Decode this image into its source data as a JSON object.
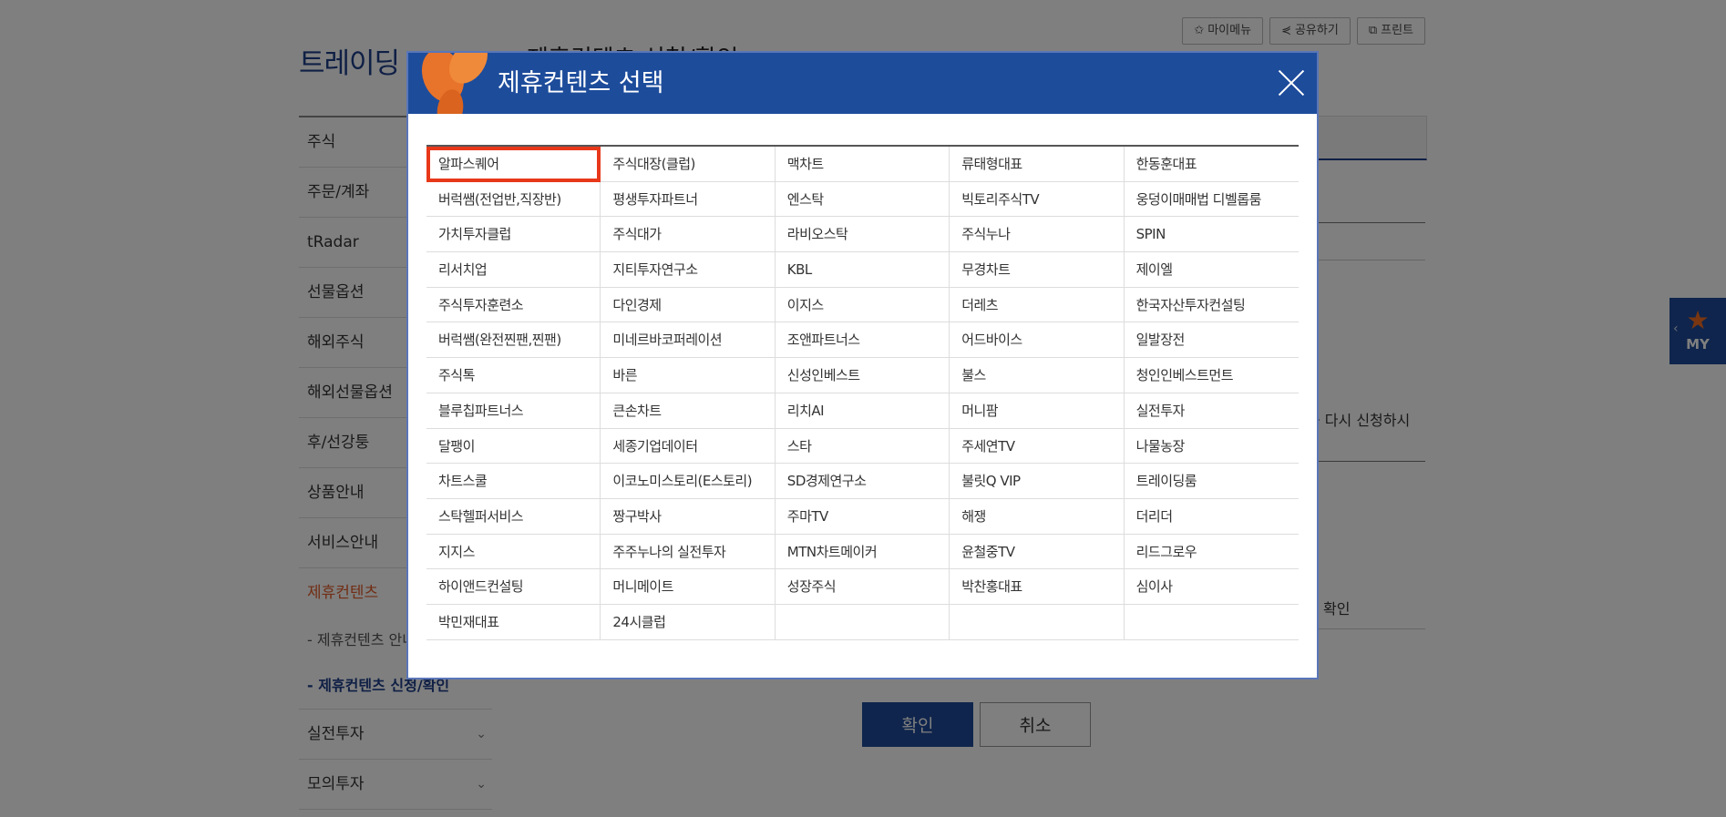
{
  "page": {
    "title": "트레이딩",
    "heading": "제휴컨텐츠 신청/확인",
    "tools": [
      {
        "icon": "star-icon",
        "glyph": "✩",
        "label": "마이메뉴"
      },
      {
        "icon": "share-icon",
        "glyph": "⋞",
        "label": "공유하기"
      },
      {
        "icon": "print-icon",
        "glyph": "⧉",
        "label": "프린트"
      }
    ],
    "bg_text_1": "를 다시 신청하시",
    "bg_text_2": "확인"
  },
  "sidebar": {
    "items": [
      "주식",
      "주문/계좌",
      "tRadar",
      "선물옵션",
      "해외주식",
      "해외선물옵션",
      "후/선강퉁",
      "상품안내",
      "서비스안내"
    ],
    "active": "제휴컨텐츠",
    "subs": [
      "- 제휴컨텐츠 안내",
      "- 제휴컨텐츠 신청/확인"
    ],
    "bottom": [
      "실전투자",
      "모의투자"
    ]
  },
  "footer_buttons": {
    "confirm": "확인",
    "cancel": "취소"
  },
  "my_tab": {
    "label": "MY"
  },
  "modal": {
    "title": "제휴컨텐츠 선택",
    "selected": "알파스퀘어",
    "cells": [
      "알파스퀘어",
      "주식대장(클럽)",
      "맥차트",
      "류태형대표",
      "한동훈대표",
      "버럭쌤(전업반,직장반)",
      "평생투자파트너",
      "엔스탁",
      "빅토리주식TV",
      "웅덩이매매법 디벨롭룸",
      "가치투자클럽",
      "주식대가",
      "라비오스탁",
      "주식누나",
      "SPIN",
      "리서치업",
      "지티투자연구소",
      "KBL",
      "무경차트",
      "제이엘",
      "주식투자훈련소",
      "다인경제",
      "이지스",
      "더레츠",
      "한국자산투자컨설팅",
      "버럭쌤(완전찐팬,찐팬)",
      "미네르바코퍼레이션",
      "조앤파트너스",
      "어드바이스",
      "일발장전",
      "주식톡",
      "바른",
      "신성인베스트",
      "불스",
      "청인인베스트먼트",
      "블루칩파트너스",
      "큰손차트",
      "리치AI",
      "머니팜",
      "실전투자",
      "달팽이",
      "세종기업데이터",
      "스타",
      "주세연TV",
      "나물농장",
      "차트스쿨",
      "이코노미스토리(E스토리)",
      "SD경제연구소",
      "불릿Q VIP",
      "트레이딩룸",
      "스탁헬퍼서비스",
      "짱구박사",
      "주마TV",
      "해쟁",
      "더리더",
      "지지스",
      "주주누나의 실전투자",
      "MTN차트메이커",
      "윤철중TV",
      "리드그로우",
      "하이앤드컨설팅",
      "머니메이트",
      "성장주식",
      "박찬홍대표",
      "심이사",
      "박민재대표",
      "24시클럽",
      "",
      "",
      ""
    ]
  }
}
